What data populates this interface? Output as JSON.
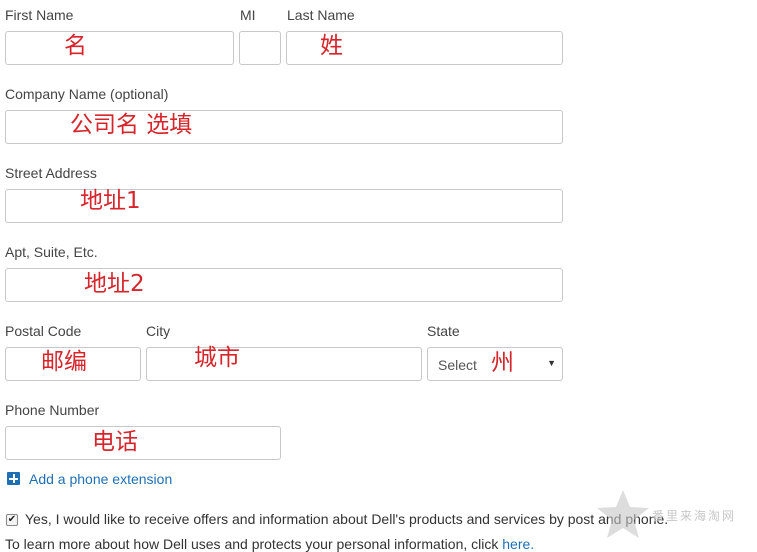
{
  "form": {
    "first_name": {
      "label": "First Name",
      "value": "名"
    },
    "mi": {
      "label": "MI",
      "value": ""
    },
    "last_name": {
      "label": "Last Name",
      "value": "姓"
    },
    "company": {
      "label": "Company Name (optional)",
      "value": "公司名 选填"
    },
    "street": {
      "label": "Street Address",
      "value": "地址1"
    },
    "apt": {
      "label": "Apt, Suite, Etc.",
      "value": "地址2"
    },
    "postal": {
      "label": "Postal Code",
      "value": "邮编"
    },
    "city": {
      "label": "City",
      "value": "城市"
    },
    "state": {
      "label": "State",
      "selected": "Select",
      "annotation": "州"
    },
    "phone": {
      "label": "Phone Number",
      "value": "电话"
    },
    "phone_extension_link": "Add a phone extension",
    "consent": {
      "checked": true,
      "text": "Yes, I would like to receive offers and information about Dell's products and services by post and phone."
    },
    "privacy": {
      "text": "To learn more about how Dell uses and protects your personal information, click ",
      "link": "here."
    }
  },
  "watermark": {
    "text": "番里来海淘网"
  },
  "colors": {
    "annotation": "#d6252b",
    "link": "#1f6fb5",
    "border": "#c8c8c8"
  }
}
